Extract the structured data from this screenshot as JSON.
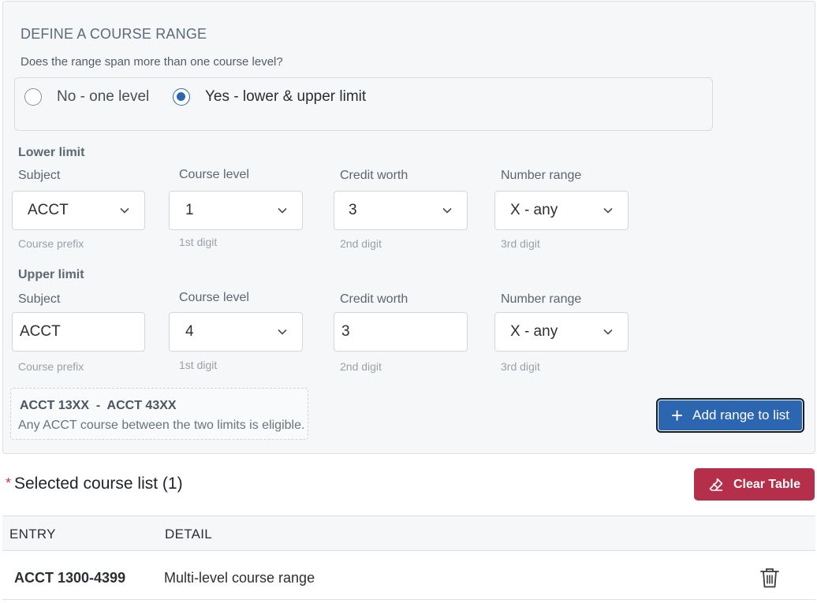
{
  "section_title": "DEFINE A COURSE RANGE",
  "question": "Does the range span more than one course level?",
  "radio_options": [
    {
      "label": "No - one level",
      "checked": false
    },
    {
      "label": "Yes - lower & upper limit",
      "checked": true
    }
  ],
  "lower": {
    "group_label": "Lower limit",
    "subject": {
      "label": "Subject",
      "value": "ACCT",
      "hint": "Course prefix"
    },
    "level": {
      "label": "Course level",
      "value": "1",
      "hint": "1st digit"
    },
    "credit": {
      "label": "Credit worth",
      "value": "3",
      "hint": "2nd digit"
    },
    "number": {
      "label": "Number range",
      "value": "X - any",
      "hint": "3rd digit"
    }
  },
  "upper": {
    "group_label": "Upper limit",
    "subject": {
      "label": "Subject",
      "value": "ACCT",
      "hint": "Course prefix"
    },
    "level": {
      "label": "Course level",
      "value": "4",
      "hint": "1st digit"
    },
    "credit": {
      "label": "Credit worth",
      "value": "3",
      "hint": "2nd digit"
    },
    "number": {
      "label": "Number range",
      "value": "X - any",
      "hint": "3rd digit"
    }
  },
  "summary": {
    "title": "ACCT 13XX  -  ACCT 43XX",
    "text": "Any ACCT course between the two limits is eligible."
  },
  "add_button_label": "Add range to list",
  "list": {
    "required_mark": "*",
    "title": "Selected course list (1)",
    "clear_label": "Clear Table",
    "columns": [
      "ENTRY",
      "DETAIL"
    ],
    "rows": [
      {
        "entry": "ACCT 1300-4399",
        "detail": "Multi-level course range"
      }
    ]
  },
  "colors": {
    "primary": "#2d66b0",
    "danger": "#b52f4b",
    "panel_bg": "#f6f7f9"
  },
  "icons": {
    "select_chevron": "chevron-down-icon",
    "add": "plus-icon",
    "clear": "eraser-icon",
    "row_delete": "trash-icon"
  }
}
